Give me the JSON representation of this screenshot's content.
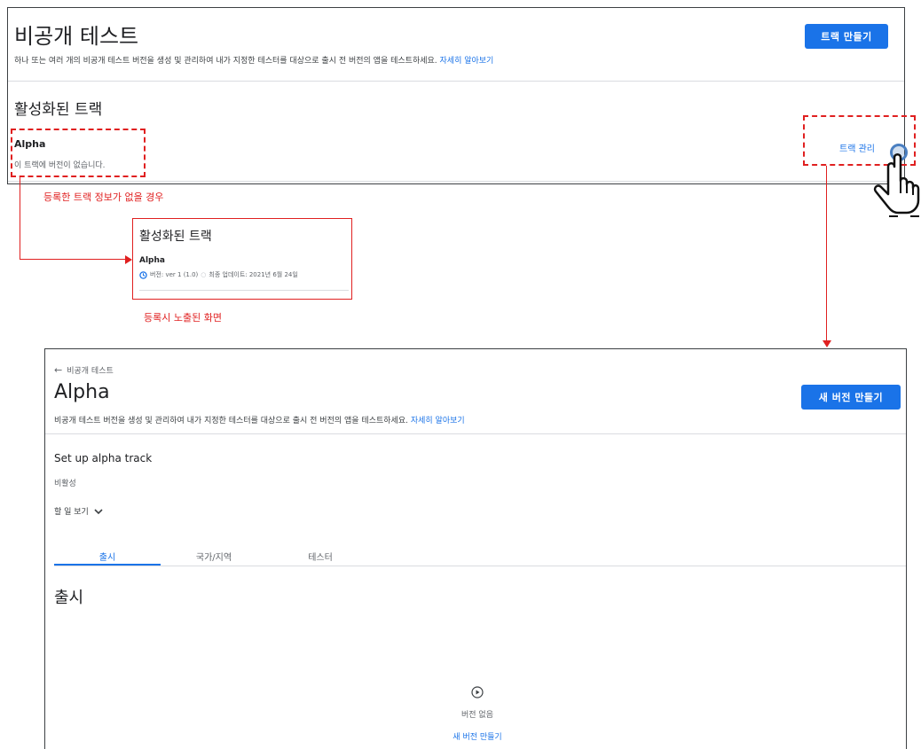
{
  "top_panel": {
    "title": "비공개 테스트",
    "description": "하나 또는 여러 개의 비공개 테스트 버전을 생성 및 관리하여 내가 지정한 테스터를 대상으로 출시 전 버전의 앱을 테스트하세요.",
    "learn_more": "자세히 알아보기",
    "create_track_button": "트랙 만들기",
    "section_title": "활성화된 트랙",
    "track_name": "Alpha",
    "track_status": "이 트랙에 버전이 없습니다.",
    "manage_track_link": "트랙 관리"
  },
  "annotations": {
    "no_info_caption": "등록한 트랙 정보가 없을 경우",
    "registered_caption": "등록시 노출된 화면"
  },
  "middle_panel": {
    "section_title": "활성화된 트랙",
    "track_name": "Alpha",
    "version_info": "버전: ver 1 (1.0)",
    "last_update": "최종 업데이트: 2021년 6월 24일"
  },
  "bottom_panel": {
    "back_link": "비공개 테스트",
    "title": "Alpha",
    "description": "비공개 테스트 버전을 생성 및 관리하여 내가 지정한 테스터를 대상으로 출시 전 버전의 앱을 테스트하세요.",
    "learn_more": "자세히 알아보기",
    "create_version_button": "새 버전 만들기",
    "setup_title": "Set up alpha track",
    "status": "비활성",
    "todo_label": "할 일 보기",
    "tabs": [
      "출시",
      "국가/지역",
      "테스터"
    ],
    "section_title": "출시",
    "empty_label": "버전 없음",
    "create_version_link": "새 버전 만들기"
  },
  "colors": {
    "accent": "#1a73e8",
    "annotation": "#e02020",
    "divider": "#dadce0"
  },
  "icons": [
    "back-arrow-icon",
    "clock-icon",
    "chevron-down-icon",
    "play-circle-icon",
    "pointer-hand-icon"
  ]
}
